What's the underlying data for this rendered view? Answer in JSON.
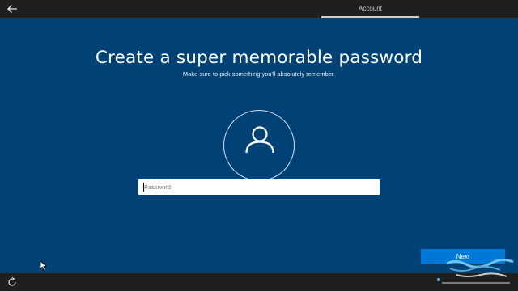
{
  "topbar": {
    "steps": [
      {
        "label": "Account",
        "active": true
      }
    ]
  },
  "main": {
    "title": "Create a super memorable password",
    "subtitle": "Make sure to pick something you'll absolutely remember.",
    "password_placeholder": "Password",
    "password_value": ""
  },
  "actions": {
    "next_label": "Next"
  },
  "icons": {
    "back": "back-arrow-icon",
    "avatar": "user-avatar-icon",
    "ease_of_access": "ease-of-access-icon",
    "cursor": "mouse-pointer-icon"
  },
  "colors": {
    "background": "#004275",
    "bar": "#1f1f1f",
    "accent": "#0078d7",
    "text": "#ffffff"
  }
}
